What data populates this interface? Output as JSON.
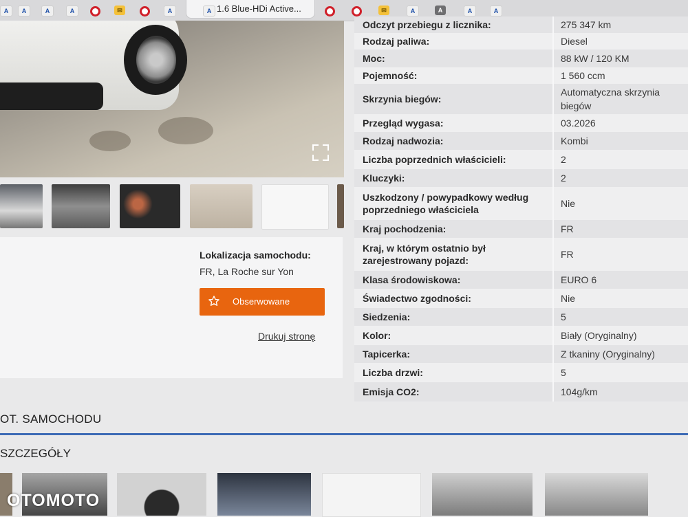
{
  "browser": {
    "active_tab_title": "1.6 Blue-HDi Active..."
  },
  "listing": {
    "location_label": "Lokalizacja samochodu:",
    "location_value": "FR, La Roche sur Yon",
    "observe_label": "Obserwowane",
    "print_label": "Drukuj stronę",
    "accent_color": "#e8650f"
  },
  "specs": [
    {
      "key": "Odczyt przebiegu z licznika:",
      "value": "275 347 km"
    },
    {
      "key": "Rodzaj paliwa:",
      "value": "Diesel"
    },
    {
      "key": "Moc:",
      "value": "88 kW / 120 KM"
    },
    {
      "key": "Pojemność:",
      "value": "1 560 ccm"
    },
    {
      "key": "Skrzynia biegów:",
      "value": "Automatyczna skrzynia biegów"
    },
    {
      "key": "Przegląd wygasa:",
      "value": "03.2026"
    },
    {
      "key": "Rodzaj nadwozia:",
      "value": "Kombi"
    },
    {
      "key": "Liczba poprzednich właścicieli:",
      "value": "2"
    },
    {
      "key": "Kluczyki:",
      "value": "2"
    },
    {
      "key": "Uszkodzony / powypadkowy według poprzedniego właściciela",
      "value": "Nie"
    },
    {
      "key": "Kraj pochodzenia:",
      "value": "FR"
    },
    {
      "key": "Kraj, w którym ostatnio był zarejestrowany pojazd:",
      "value": "FR"
    },
    {
      "key": "Klasa środowiskowa:",
      "value": "EURO 6"
    },
    {
      "key": "Świadectwo zgodności:",
      "value": "Nie"
    },
    {
      "key": "Siedzenia:",
      "value": "5"
    },
    {
      "key": "Kolor:",
      "value": "Biały (Oryginalny)"
    },
    {
      "key": "Tapicerka:",
      "value": "Z tkaniny (Oryginalny)"
    },
    {
      "key": "Liczba drzwi:",
      "value": "5"
    },
    {
      "key": "Emisja CO2:",
      "value": "104g/km"
    }
  ],
  "sections": {
    "section_title": "OT. SAMOCHODU",
    "subsection_title": "SZCZEGÓŁY"
  },
  "watermark": "OTOMOTO"
}
